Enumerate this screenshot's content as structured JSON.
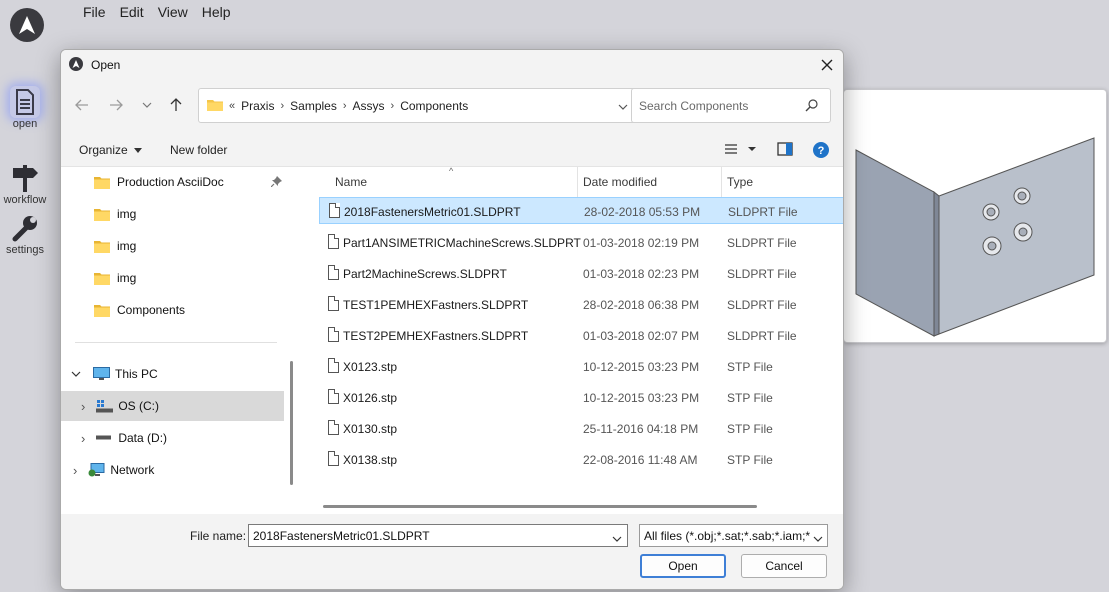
{
  "app": {
    "menu": [
      "File",
      "Edit",
      "View",
      "Help"
    ],
    "tools": [
      {
        "label": "open",
        "icon": "document-icon"
      },
      {
        "label": "workflow",
        "icon": "signpost-icon"
      },
      {
        "label": "settings",
        "icon": "wrench-icon"
      }
    ]
  },
  "dialog": {
    "title": "Open",
    "breadcrumb_prefix": "«",
    "breadcrumb": [
      "Praxis",
      "Samples",
      "Assys",
      "Components"
    ],
    "search_placeholder": "Search Components",
    "toolbar": {
      "organize": "Organize",
      "new_folder": "New folder"
    },
    "nav": {
      "quick_access": [
        {
          "label": "Production AsciiDoc",
          "pinned": true
        },
        {
          "label": "img"
        },
        {
          "label": "img"
        },
        {
          "label": "img"
        },
        {
          "label": "Components"
        }
      ],
      "this_pc": "This PC",
      "drives": [
        {
          "label": "OS (C:)",
          "selected": true
        },
        {
          "label": "Data (D:)"
        }
      ],
      "network": "Network"
    },
    "columns": {
      "name": "Name",
      "date": "Date modified",
      "type": "Type"
    },
    "files": [
      {
        "name": "2018FastenersMetric01.SLDPRT",
        "date": "28-02-2018 05:53 PM",
        "type": "SLDPRT File",
        "selected": true
      },
      {
        "name": "Part1ANSIMETRICMachineScrews.SLDPRT",
        "date": "01-03-2018 02:19 PM",
        "type": "SLDPRT File"
      },
      {
        "name": "Part2MachineScrews.SLDPRT",
        "date": "01-03-2018 02:23 PM",
        "type": "SLDPRT File"
      },
      {
        "name": "TEST1PEMHEXFastners.SLDPRT",
        "date": "28-02-2018 06:38 PM",
        "type": "SLDPRT File"
      },
      {
        "name": "TEST2PEMHEXFastners.SLDPRT",
        "date": "01-03-2018 02:07 PM",
        "type": "SLDPRT File"
      },
      {
        "name": "X0123.stp",
        "date": "10-12-2015 03:23 PM",
        "type": "STP File"
      },
      {
        "name": "X0126.stp",
        "date": "10-12-2015 03:23 PM",
        "type": "STP File"
      },
      {
        "name": "X0130.stp",
        "date": "25-11-2016 04:18 PM",
        "type": "STP File"
      },
      {
        "name": "X0138.stp",
        "date": "22-08-2016 11:48 AM",
        "type": "STP File"
      }
    ],
    "file_name_label": "File name:",
    "file_name_value": "2018FastenersMetric01.SLDPRT",
    "filter": "All files (*.obj;*.sat;*.sab;*.iam;*",
    "open_label": "Open",
    "cancel_label": "Cancel"
  }
}
